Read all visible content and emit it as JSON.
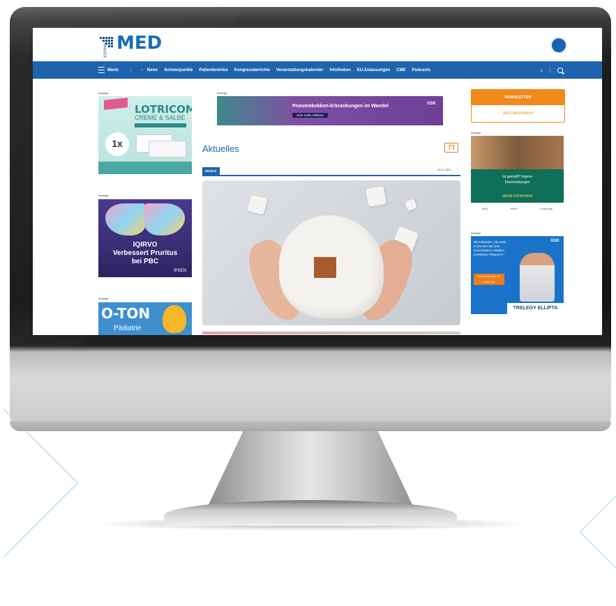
{
  "site": {
    "logo_text": "MED",
    "logo_sub": "JOURNAL"
  },
  "nav": {
    "menu_label": "Menü",
    "items": [
      "News",
      "Schwerpunkte",
      "Patienteninfos",
      "Kongressberichte",
      "Veranstaltungskalender",
      "Infotheken",
      "EU-Zulassungen",
      "CME",
      "Podcasts"
    ]
  },
  "ads": {
    "label": "Anzeige",
    "left1": {
      "brand": "LOTRICOMB",
      "brand2": "CREME & SALBE",
      "badge": "1x"
    },
    "left2": {
      "line1": "IQIRVO",
      "line2": "Verbessert Pruritus",
      "line3": "bei PBC",
      "logo": "IPSEN"
    },
    "left3": {
      "title": "O-TON",
      "subtitle": "Pädiatrie"
    },
    "center": {
      "title": "Pneumokokken-Erkrankungen im Wandel",
      "button": "Jetzt mehr erfahren",
      "logo": "GSK"
    },
    "right1": {
      "line1": "Ist geimpft? Eigene",
      "line2": "Entscheidungen",
      "highlight": "MEHR ERFAHREN",
      "foot1": "MSD",
      "foot2": "Pfizer",
      "foot3": "Comirnaty"
    },
    "right2": {
      "text": "Bei Patienten, die unter ICS/LABA auf eine Exazerbation erleiden, kombiniert TRELEGY",
      "logo": "GSK",
      "button": "Sehen Sie sich die Daten an",
      "brand": "TRELEGY ELLIPTA"
    }
  },
  "newsletter": {
    "header": "NEWSLETTER",
    "button": "Jetzt abonnieren"
  },
  "main": {
    "section_title": "Aktuelles",
    "tag": "Medizin",
    "date": "06.11.2024"
  }
}
